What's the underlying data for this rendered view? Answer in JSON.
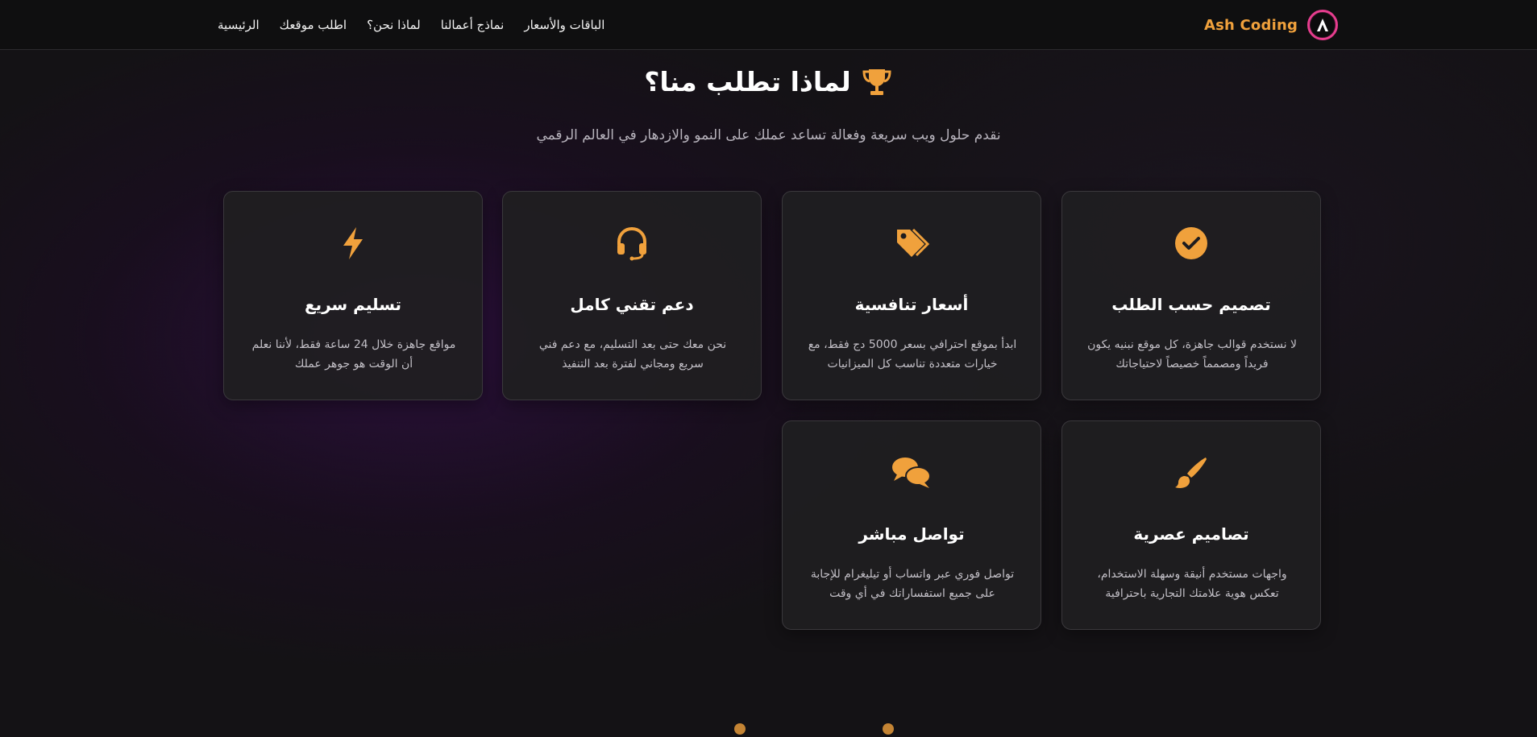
{
  "brand": {
    "name": "Ash Coding",
    "logo_letter": "A"
  },
  "nav": {
    "links": [
      "الرئيسية",
      "اطلب موقعك",
      "لماذا نحن؟",
      "نماذج أعمالنا",
      "الباقات والأسعار"
    ]
  },
  "section": {
    "title": "لماذا تطلب منا؟",
    "title_icon": "trophy-icon",
    "subtitle": "نقدم حلول ويب سريعة وفعالة تساعد عملك على النمو والازدهار في العالم الرقمي"
  },
  "features": [
    {
      "icon": "check-circle-icon",
      "title": "تصميم حسب الطلب",
      "text": "لا نستخدم قوالب جاهزة، كل موقع نبنيه يكون فريداً ومصمماً خصيصاً لاحتياجاتك"
    },
    {
      "icon": "tags-icon",
      "title": "أسعار تنافسية",
      "text": "ابدأ بموقع احترافي بسعر 5000 دج فقط، مع خيارات متعددة تناسب كل الميزانيات"
    },
    {
      "icon": "headset-icon",
      "title": "دعم تقني كامل",
      "text": "نحن معك حتى بعد التسليم، مع دعم فني سريع ومجاني لفترة بعد التنفيذ"
    },
    {
      "icon": "lightning-icon",
      "title": "تسليم سريع",
      "text": "مواقع جاهزة خلال 24 ساعة فقط، لأننا نعلم أن الوقت هو جوهر عملك"
    },
    {
      "icon": "paintbrush-icon",
      "title": "تصاميم عصرية",
      "text": "واجهات مستخدم أنيقة وسهلة الاستخدام، تعكس هوية علامتك التجارية باحترافية"
    },
    {
      "icon": "comments-icon",
      "title": "تواصل مباشر",
      "text": "تواصل فوري عبر واتساب أو تيليغرام للإجابة على جميع استفساراتك في أي وقت"
    }
  ],
  "colors": {
    "accent": "#f0a13c",
    "logo_ring": "#e63d8e",
    "background": "#141215"
  }
}
